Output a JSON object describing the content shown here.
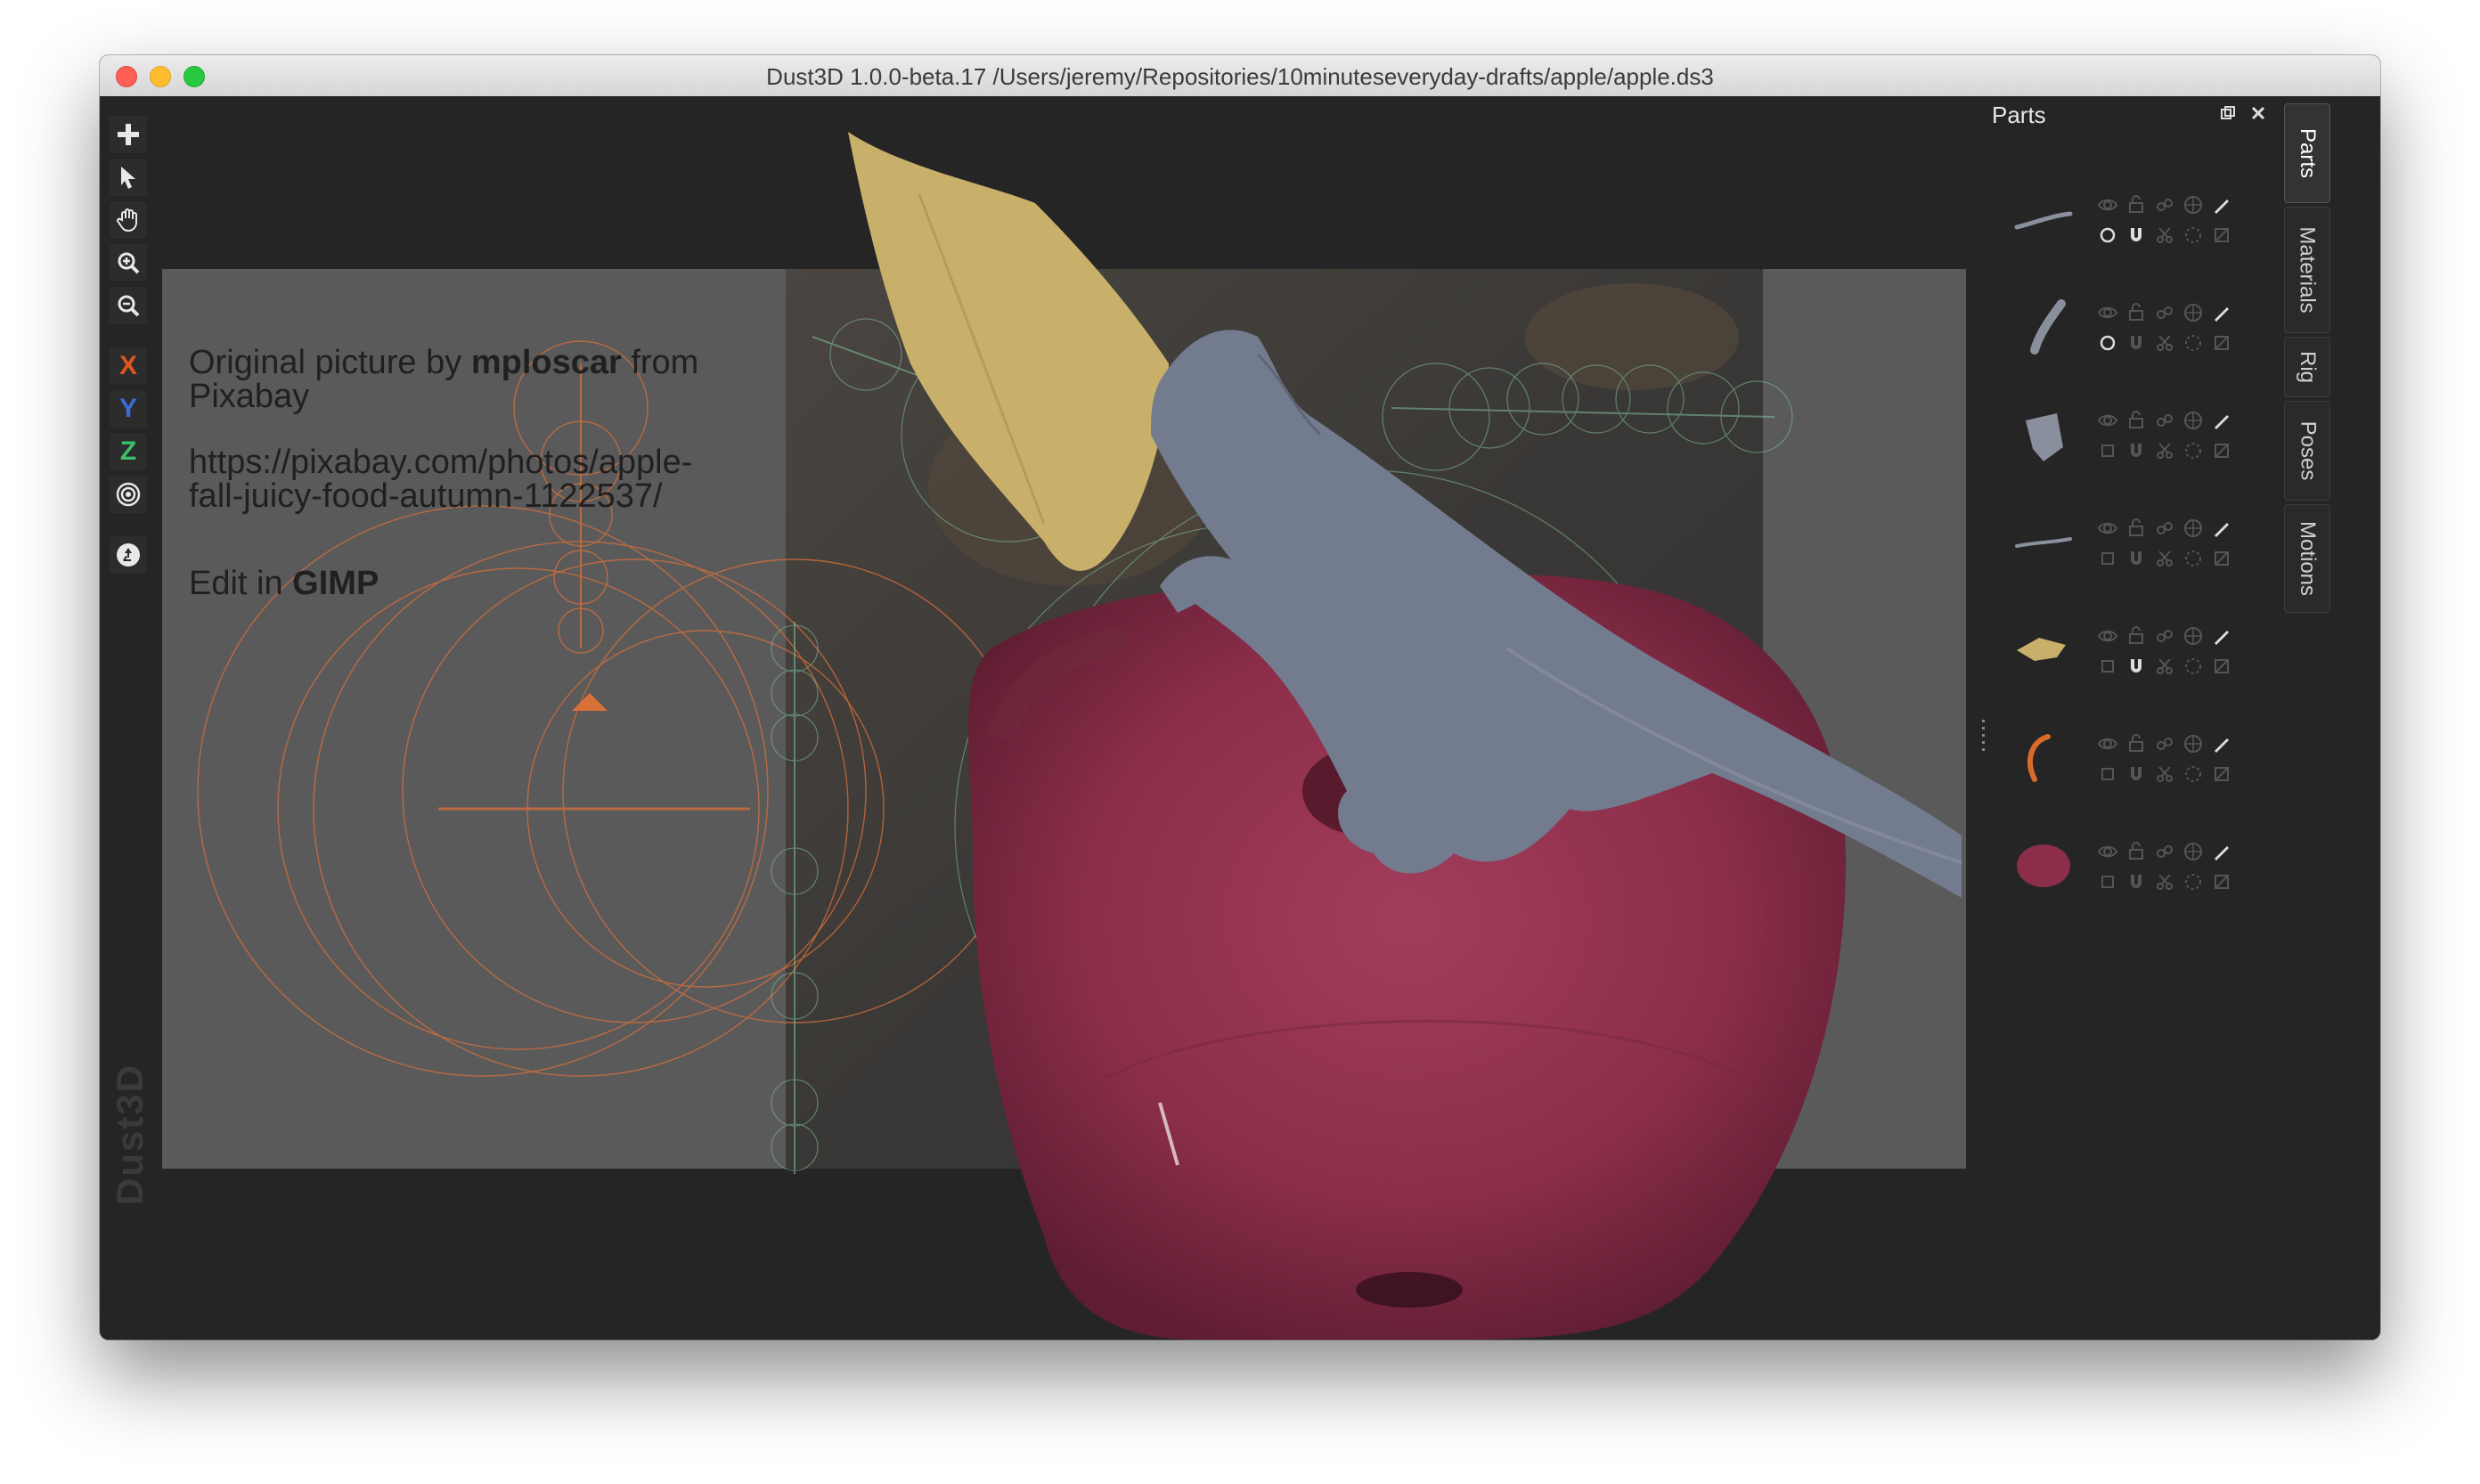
{
  "window": {
    "title": "Dust3D 1.0.0-beta.17 /Users/jeremy/Repositories/10minuteseveryday-drafts/apple/apple.ds3"
  },
  "toolbar": {
    "tools": [
      {
        "name": "add-icon"
      },
      {
        "name": "select-arrow-icon"
      },
      {
        "name": "hand-pan-icon"
      },
      {
        "name": "zoom-in-icon"
      },
      {
        "name": "zoom-out-icon"
      }
    ],
    "axis_x": "X",
    "axis_y": "Y",
    "axis_z": "Z",
    "axis_colors": {
      "x": "#e0541f",
      "y": "#3a6bd6",
      "z": "#3bbf6a"
    },
    "radial_icon": "radial-mirror-icon",
    "recycle_icon": "recycle-icon"
  },
  "watermark": "Dust3D",
  "reference_note": {
    "line1_prefix": "Original picture by ",
    "line1_author": "mploscar",
    "line1_suffix": " from",
    "line2": "Pixabay",
    "url_line1": "https://pixabay.com/photos/apple-",
    "url_line2": "fall-juicy-food-autumn-1122537/",
    "edit_prefix": "Edit in ",
    "edit_app": "GIMP"
  },
  "parts_panel": {
    "title": "Parts",
    "rows": [
      {
        "thumb": "branch-thin",
        "color": "#8a8f9e",
        "locked": false
      },
      {
        "thumb": "branch-bent",
        "color": "#8a8f9e",
        "locked": false
      },
      {
        "thumb": "branch-stump",
        "color": "#8a8f9e",
        "locked": false
      },
      {
        "thumb": "branch-flat",
        "color": "#8a8f9e",
        "locked": false
      },
      {
        "thumb": "leaf",
        "color": "#c9b06a",
        "locked": true
      },
      {
        "thumb": "stem",
        "color": "#d96a2a",
        "locked": false
      },
      {
        "thumb": "apple",
        "color": "#8c2e4a",
        "locked": false
      }
    ]
  },
  "side_tabs": [
    "Parts",
    "Materials",
    "Rig",
    "Poses",
    "Motions"
  ],
  "colors": {
    "apple": "#8c2e4a",
    "leaf": "#c9b06a",
    "branch": "#737b8e",
    "guide": "#d9703a"
  }
}
